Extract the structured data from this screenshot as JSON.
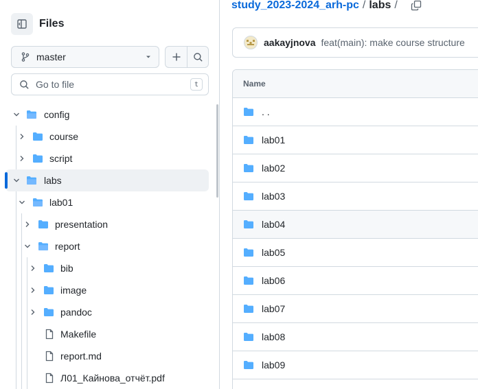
{
  "sidebar": {
    "title": "Files",
    "branch": "master",
    "search_placeholder": "Go to file",
    "search_shortcut": "t",
    "tree": [
      {
        "label": "config",
        "type": "folder",
        "depth": 0,
        "expanded": true
      },
      {
        "label": "course",
        "type": "folder",
        "depth": 1,
        "expanded": false
      },
      {
        "label": "script",
        "type": "folder",
        "depth": 1,
        "expanded": false
      },
      {
        "label": "labs",
        "type": "folder",
        "depth": 0,
        "expanded": true,
        "active": true
      },
      {
        "label": "lab01",
        "type": "folder",
        "depth": 1,
        "expanded": true
      },
      {
        "label": "presentation",
        "type": "folder",
        "depth": 2,
        "expanded": false
      },
      {
        "label": "report",
        "type": "folder",
        "depth": 2,
        "expanded": true
      },
      {
        "label": "bib",
        "type": "folder",
        "depth": 3,
        "expanded": false
      },
      {
        "label": "image",
        "type": "folder",
        "depth": 3,
        "expanded": false
      },
      {
        "label": "pandoc",
        "type": "folder",
        "depth": 3,
        "expanded": false
      },
      {
        "label": "Makefile",
        "type": "file",
        "depth": 3
      },
      {
        "label": "report.md",
        "type": "file",
        "depth": 3
      },
      {
        "label": "Л01_Кайнова_отчёт.pdf",
        "type": "file",
        "depth": 3
      }
    ]
  },
  "main": {
    "breadcrumb": {
      "repo": "study_2023-2024_arh-pc",
      "sep1": "/",
      "current": "labs",
      "sep2": "/"
    },
    "commit": {
      "author": "aakayjnova",
      "message": "feat(main): make course structure"
    },
    "table": {
      "header": "Name",
      "rows": [
        {
          "name": ". ."
        },
        {
          "name": "lab01"
        },
        {
          "name": "lab02"
        },
        {
          "name": "lab03"
        },
        {
          "name": "lab04",
          "hover": true
        },
        {
          "name": "lab05"
        },
        {
          "name": "lab06"
        },
        {
          "name": "lab07"
        },
        {
          "name": "lab08"
        },
        {
          "name": "lab09"
        },
        {
          "name": ""
        }
      ]
    }
  },
  "colors": {
    "accent": "#0969da",
    "folder": "#54aeff",
    "border": "#d1d9e0",
    "muted": "#59636e"
  }
}
